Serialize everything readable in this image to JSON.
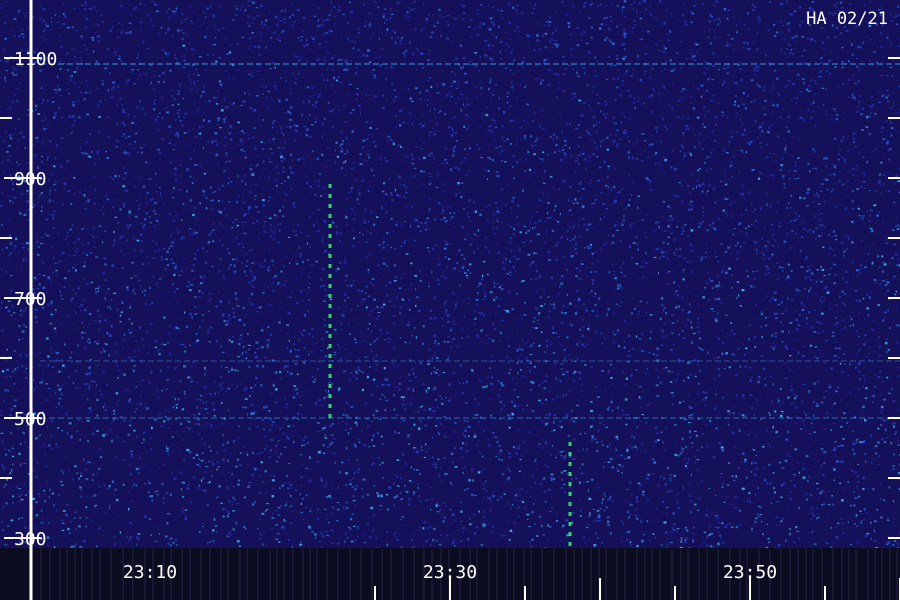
{
  "chart_data": {
    "type": "heatmap",
    "title": "HA 02/21",
    "xlabel": "",
    "ylabel": "",
    "x_ticks": [
      "23:10",
      "23:30",
      "23:50"
    ],
    "y_ticks": [
      "1100",
      "900",
      "700",
      "500",
      "300"
    ],
    "x_range_minutes": [
      23.5,
      85
    ],
    "y_range": [
      270,
      1150
    ],
    "grid": false,
    "colors": {
      "background": "#14105a",
      "noise_dim": "#2a2ab0",
      "noise_bright": "#3ea8e8",
      "signal": "#33ee66",
      "axis": "#ffffff",
      "floor": "#0c0c20"
    },
    "vertical_events": [
      {
        "time": "23:22",
        "freq_low": 500,
        "freq_high": 890,
        "color": "#33ee66"
      },
      {
        "time": "23:38",
        "freq_low": 285,
        "freq_high": 460,
        "color": "#33ee66"
      }
    ],
    "horizontal_lines": [
      {
        "freq": 1090,
        "intensity": 0.6
      },
      {
        "freq": 500,
        "intensity": 0.4
      },
      {
        "freq": 595,
        "intensity": 0.3
      }
    ]
  }
}
